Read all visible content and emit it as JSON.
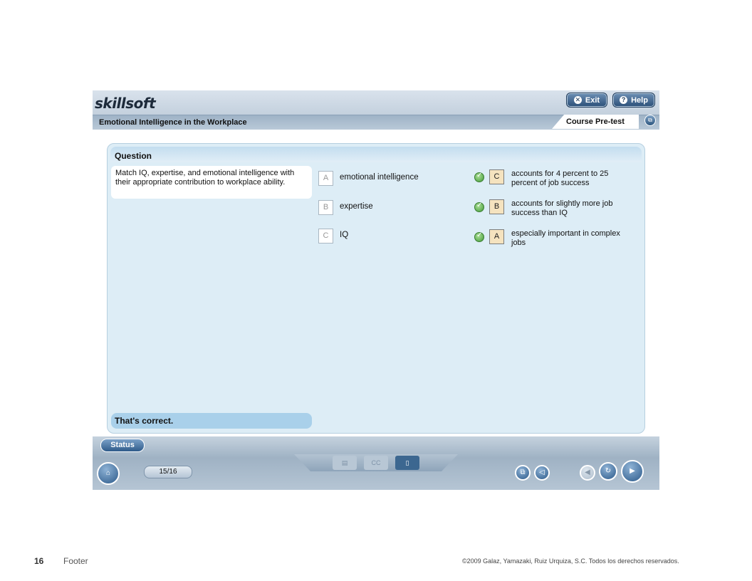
{
  "header": {
    "logo": "skillsoft",
    "exit_label": "Exit",
    "help_label": "Help",
    "course_title": "Emotional Intelligence in the Workplace",
    "tab_label": "Course Pre-test"
  },
  "question": {
    "label": "Question",
    "text": "Match IQ, expertise, and emotional intelligence with their appropriate contribution to workplace ability.",
    "items": [
      {
        "letter": "A",
        "label": "emotional intelligence"
      },
      {
        "letter": "B",
        "label": "expertise"
      },
      {
        "letter": "C",
        "label": "IQ"
      }
    ],
    "answers": [
      {
        "letter": "C",
        "text": "accounts for 4 percent to 25 percent of job success"
      },
      {
        "letter": "B",
        "text": "accounts for slightly more job success than IQ"
      },
      {
        "letter": "A",
        "text": "especially important in complex jobs"
      }
    ],
    "feedback": "That's correct."
  },
  "bottom_bar": {
    "status_label": "Status",
    "page_counter": "15/16"
  },
  "footer": {
    "page_number": "16",
    "label": "Footer",
    "copyright": "©2009 Galaz, Yamazaki, Ruiz Urquiza, S.C. Todos los derechos reservados."
  }
}
